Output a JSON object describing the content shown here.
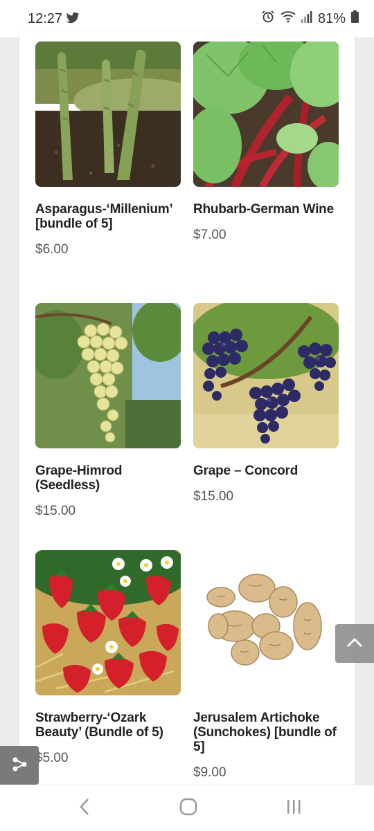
{
  "status_bar": {
    "time": "12:27",
    "battery": "81%"
  },
  "products": [
    {
      "name": "Asparagus-‘Millenium’ [bundle of 5]",
      "price": "$6.00"
    },
    {
      "name": "Rhubarb-German Wine",
      "price": "$7.00"
    },
    {
      "name": "Grape-Himrod (Seedless)",
      "price": "$15.00"
    },
    {
      "name": "Grape – Concord",
      "price": "$15.00"
    },
    {
      "name": "Strawberry-‘Ozark Beauty’ (Bundle of 5)",
      "price": "$5.00"
    },
    {
      "name": "Jerusalem Artichoke (Sunchokes) [bundle of 5]",
      "price": "$9.00"
    }
  ],
  "icons": {
    "status": [
      "twitter-icon",
      "alarm-icon",
      "wifi-icon",
      "signal-icon",
      "battery-icon"
    ],
    "floating": [
      "scroll-to-top-icon",
      "share-icon"
    ],
    "nav": [
      "back-icon",
      "home-icon",
      "recents-icon"
    ]
  },
  "colors": {
    "page_bg": "#ffffff",
    "outer_bg": "#ececec",
    "title_text": "#222222",
    "price_text": "#555555"
  }
}
